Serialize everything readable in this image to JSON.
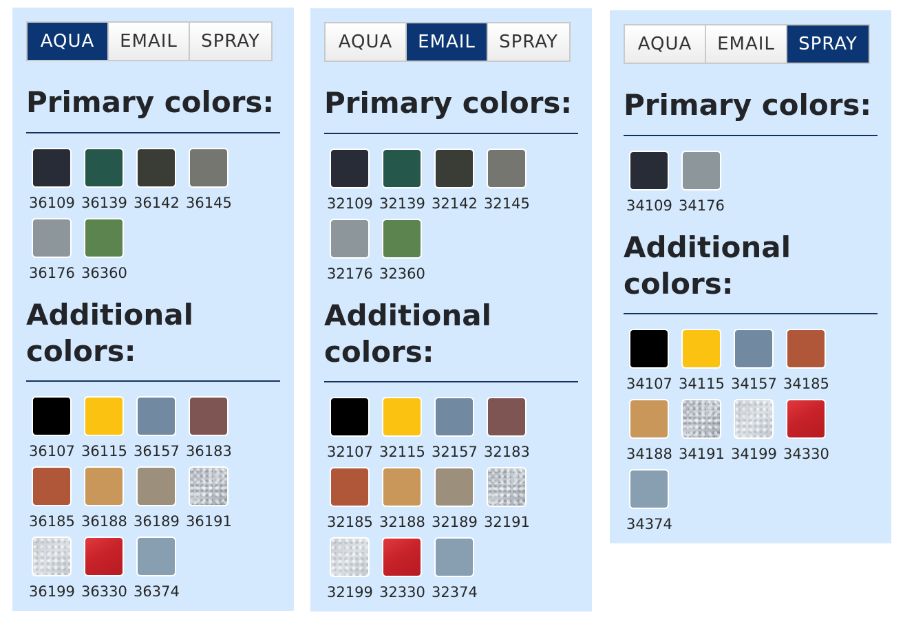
{
  "tabs": [
    "AQUA",
    "EMAIL",
    "SPRAY"
  ],
  "headings": {
    "primary": "Primary colors:",
    "additional_line1": "Additional",
    "additional_line2": "colors:"
  },
  "panels": [
    {
      "active_tab": "AQUA",
      "primary": [
        {
          "code": "36109",
          "color": "#272c36"
        },
        {
          "code": "36139",
          "color": "#25574a"
        },
        {
          "code": "36142",
          "color": "#393d35"
        },
        {
          "code": "36145",
          "color": "#74766f"
        },
        {
          "code": "36176",
          "color": "#8c969b"
        },
        {
          "code": "36360",
          "color": "#5b844e"
        }
      ],
      "additional": [
        {
          "code": "36107",
          "color": "#000000"
        },
        {
          "code": "36115",
          "color": "#fbc212"
        },
        {
          "code": "36157",
          "color": "#718aa2"
        },
        {
          "code": "36183",
          "color": "#7e5552"
        },
        {
          "code": "36185",
          "color": "#b0573a"
        },
        {
          "code": "36188",
          "color": "#c9975a"
        },
        {
          "code": "36189",
          "color": "#9c8f7b"
        },
        {
          "code": "36191",
          "color": "#b2b7be",
          "finish": "metal-a"
        },
        {
          "code": "36199",
          "color": "#d1d5da",
          "finish": "metal-b"
        },
        {
          "code": "36330",
          "color": "#c8262a",
          "finish": "glossy-red"
        },
        {
          "code": "36374",
          "color": "#889fb1"
        }
      ]
    },
    {
      "active_tab": "EMAIL",
      "primary": [
        {
          "code": "32109",
          "color": "#272c36"
        },
        {
          "code": "32139",
          "color": "#25574a"
        },
        {
          "code": "32142",
          "color": "#393d35"
        },
        {
          "code": "32145",
          "color": "#74766f"
        },
        {
          "code": "32176",
          "color": "#8c969b"
        },
        {
          "code": "32360",
          "color": "#5b844e"
        }
      ],
      "additional": [
        {
          "code": "32107",
          "color": "#000000"
        },
        {
          "code": "32115",
          "color": "#fbc212"
        },
        {
          "code": "32157",
          "color": "#718aa2"
        },
        {
          "code": "32183",
          "color": "#7e5552"
        },
        {
          "code": "32185",
          "color": "#b0573a"
        },
        {
          "code": "32188",
          "color": "#c9975a"
        },
        {
          "code": "32189",
          "color": "#9c8f7b"
        },
        {
          "code": "32191",
          "color": "#b2b7be",
          "finish": "metal-a"
        },
        {
          "code": "32199",
          "color": "#d1d5da",
          "finish": "metal-b"
        },
        {
          "code": "32330",
          "color": "#c8262a",
          "finish": "glossy-red"
        },
        {
          "code": "32374",
          "color": "#889fb1"
        }
      ]
    },
    {
      "active_tab": "SPRAY",
      "primary": [
        {
          "code": "34109",
          "color": "#272c36"
        },
        {
          "code": "34176",
          "color": "#8c969b"
        }
      ],
      "additional": [
        {
          "code": "34107",
          "color": "#000000"
        },
        {
          "code": "34115",
          "color": "#fbc212"
        },
        {
          "code": "34157",
          "color": "#718aa2"
        },
        {
          "code": "34185",
          "color": "#b0573a"
        },
        {
          "code": "34188",
          "color": "#c9975a"
        },
        {
          "code": "34191",
          "color": "#b2b7be",
          "finish": "metal-a"
        },
        {
          "code": "34199",
          "color": "#d1d5da",
          "finish": "metal-b"
        },
        {
          "code": "34330",
          "color": "#c8262a",
          "finish": "glossy-red"
        },
        {
          "code": "34374",
          "color": "#889fb1"
        }
      ]
    }
  ]
}
